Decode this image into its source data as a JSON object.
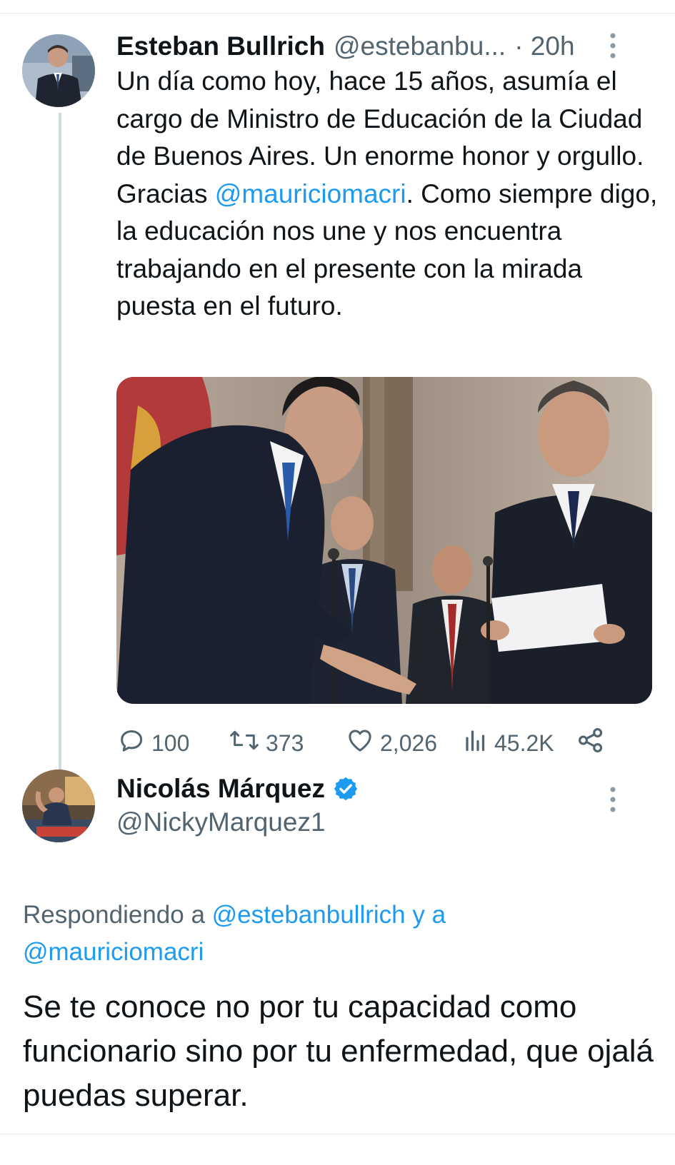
{
  "tweet": {
    "author_name": "Esteban Bullrich",
    "author_handle": "@estebanbu...",
    "time": "· 20h",
    "text_before_mention": "Un día como hoy, hace 15 años, asumía el cargo de Ministro de Educación de la Ciudad de Buenos Aires. Un enorme honor y orgullo. Gracias ",
    "mention": "@mauriciomacri",
    "text_after_mention": ". Como siempre digo, la educación nos une y nos encuentra trabajando en el presente con la mirada puesta en el futuro.",
    "stats": {
      "replies": "100",
      "retweets": "373",
      "likes": "2,026",
      "views": "45.2K"
    },
    "icons": [
      "avatar",
      "more-icon",
      "reply-icon",
      "retweet-icon",
      "like-icon",
      "views-icon",
      "share-icon"
    ]
  },
  "reply": {
    "author_name": "Nicolás Márquez",
    "author_handle": "@NickyMarquez1",
    "verified": true,
    "replying_prefix": "Respondiendo a ",
    "replying_user1": "@estebanbullrich",
    "replying_join": " y a",
    "replying_user2": "@mauriciomacri",
    "text": "Se te conoce no por tu capacidad como funcionario sino por tu enfermedad, que ojalá puedas superar."
  },
  "colors": {
    "accent": "#1d9bf0",
    "muted": "#536471",
    "text": "#0f1419",
    "thread_line": "#cfd9de"
  }
}
